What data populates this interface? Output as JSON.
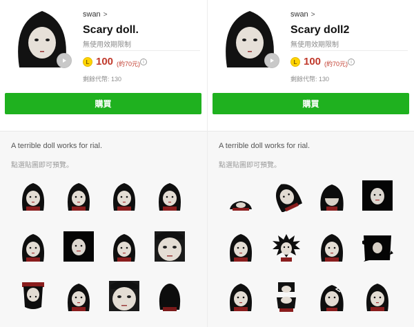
{
  "colors": {
    "buy_button": "#1fb11f",
    "price": "#c0392b",
    "coin": "#ffd400"
  },
  "panels": [
    {
      "author": "swan",
      "author_chevron": ">",
      "title": "Scary doll.",
      "validity": "無使用效期限制",
      "coin_symbol": "L",
      "price": "100",
      "price_sub": "(約70元)",
      "info_symbol": "i",
      "remaining": "剩餘代幣: 130",
      "buy_label": "購買",
      "description": "A terrible doll works for rial.",
      "hint": "點選貼圖即可預覽。",
      "stickers": [
        {
          "variant": "normal"
        },
        {
          "variant": "normal"
        },
        {
          "variant": "normal"
        },
        {
          "variant": "normal"
        },
        {
          "variant": "normal"
        },
        {
          "variant": "dark-box"
        },
        {
          "variant": "normal"
        },
        {
          "variant": "closeup"
        },
        {
          "variant": "upside"
        },
        {
          "variant": "normal"
        },
        {
          "variant": "closeup"
        },
        {
          "variant": "back"
        }
      ]
    },
    {
      "author": "swan",
      "author_chevron": ">",
      "title": "Scary doll2",
      "validity": "無使用效期限制",
      "coin_symbol": "L",
      "price": "100",
      "price_sub": "(約70元)",
      "info_symbol": "i",
      "remaining": "剩餘代幣: 130",
      "buy_label": "購買",
      "description": "A terrible doll works for rial.",
      "hint": "點選貼圖即可預覽。",
      "stickers": [
        {
          "variant": "low"
        },
        {
          "variant": "tilted"
        },
        {
          "variant": "shadow-face"
        },
        {
          "variant": "dark-box"
        },
        {
          "variant": "normal"
        },
        {
          "variant": "spiky"
        },
        {
          "variant": "normal"
        },
        {
          "variant": "splat"
        },
        {
          "variant": "normal"
        },
        {
          "variant": "split"
        },
        {
          "variant": "cracked"
        },
        {
          "variant": "normal"
        }
      ]
    }
  ]
}
